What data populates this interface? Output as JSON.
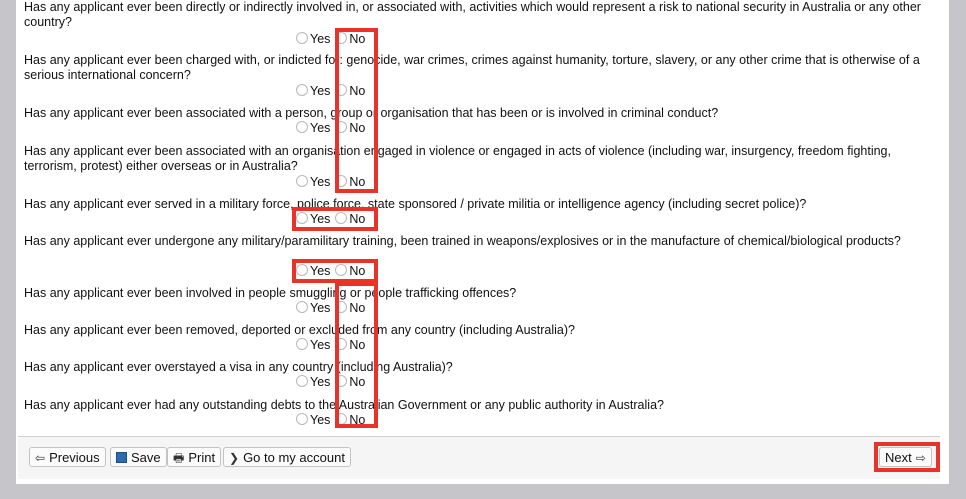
{
  "questions": [
    {
      "text": "Has any applicant ever been directly or indirectly involved in, or associated with, activities which would represent a risk to national security in Australia or any other country?",
      "yes": "Yes",
      "no": "No"
    },
    {
      "text": "Has any applicant ever been charged with, or indicted for: genocide, war crimes, crimes against humanity, torture, slavery, or any other crime that is otherwise of a serious international concern?",
      "yes": "Yes",
      "no": "No"
    },
    {
      "text": "Has any applicant ever been associated with a person, group or organisation that has been or is involved in criminal conduct?",
      "yes": "Yes",
      "no": "No"
    },
    {
      "text": "Has any applicant ever been associated with an organisation engaged in violence or engaged in acts of violence (including war, insurgency, freedom fighting, terrorism, protest) either overseas or in Australia?",
      "yes": "Yes",
      "no": "No"
    },
    {
      "text": "Has any applicant ever served in a military force, police force, state sponsored / private militia or intelligence agency (including secret police)?",
      "yes": "Yes",
      "no": "No"
    },
    {
      "text": "Has any applicant ever undergone any military/paramilitary training, been trained in weapons/explosives or in the manufacture of chemical/biological products?",
      "yes": "Yes",
      "no": "No"
    },
    {
      "text": "Has any applicant ever been involved in people smuggling or people trafficking offences?",
      "yes": "Yes",
      "no": "No"
    },
    {
      "text": "Has any applicant ever been removed, deported or excluded from any country (including Australia)?",
      "yes": "Yes",
      "no": "No"
    },
    {
      "text": "Has any applicant ever overstayed a visa in any country (including Australia)?",
      "yes": "Yes",
      "no": "No"
    },
    {
      "text": "Has any applicant ever had any outstanding debts to the Australian Government or any public authority in Australia?",
      "yes": "Yes",
      "no": "No"
    }
  ],
  "footer": {
    "previous_label": "Previous",
    "save_label": "Save",
    "print_label": "Print",
    "account_label": "Go to my account",
    "next_label": "Next"
  },
  "icons": {
    "previous": "arrow-left-icon",
    "save": "floppy-disk-icon",
    "print": "printer-icon",
    "account": "chevron-right-icon",
    "next": "arrow-right-icon"
  },
  "colors": {
    "highlight": "#e8332b",
    "background": "#c6c6ca"
  }
}
